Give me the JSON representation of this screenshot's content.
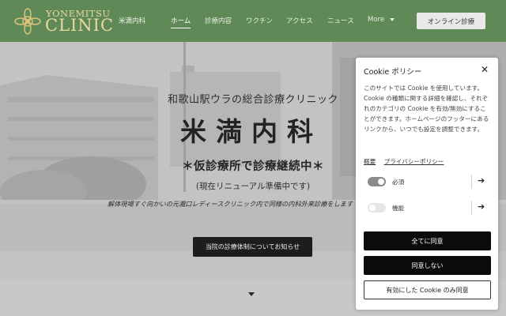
{
  "header": {
    "logo_top": "YONEMITSU",
    "logo_main": "CLINIC",
    "brand_sub": "米満内科",
    "nav": [
      "ホーム",
      "診療内容",
      "ワクチン",
      "アクセス",
      "ニュース",
      "More"
    ],
    "online_button": "オンライン診療"
  },
  "hero": {
    "subtitle": "和歌山駅ウラの総合診療クリニック",
    "title": "米満内科",
    "notice": "＊仮診療所で診療継続中＊",
    "paren": "(現在リニューアル準備中です)",
    "italic": "解体現場すぐ向かいの元瀧口レディースクリニック内で同様の内科外来診療をします",
    "button": "当院の診療体制についてお知らせ"
  },
  "cookie": {
    "title": "Cookie ポリシー",
    "body": "このサイトでは Cookie を使用しています。Cookie の種類に関する詳細を確認し、それぞれのカテゴリの Cookie を有効/無効にすることができます。ホームページのフッターにあるリンクから、いつでも設定を調整できます。",
    "link_overview": "概要",
    "link_privacy": "プライバシーポリシー",
    "row_required": "必須",
    "row_function": "機能",
    "accept_all": "全てに同意",
    "decline": "同意しない",
    "accept_enabled": "有効にした Cookie のみ同意"
  },
  "colors": {
    "header_green": "#5f8a57",
    "logo_gold": "#e8d9a0"
  }
}
